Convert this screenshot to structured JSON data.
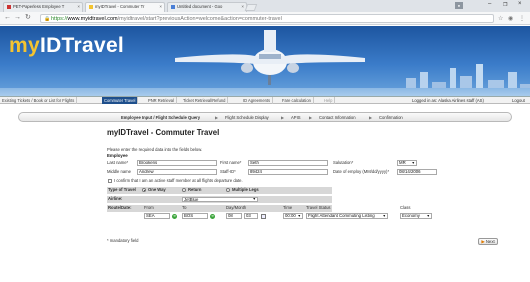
{
  "browser": {
    "tabs": [
      {
        "label": "PET-Paperless Employee T"
      },
      {
        "label": "myIDTravel - Commuter Tr"
      },
      {
        "label": "Untitled document - Goo"
      }
    ],
    "url_scheme": "https://",
    "url_host": "www.myidtravel.com",
    "url_path": "/myidtravel/start?previousAction=welcome&action=commuter-travel"
  },
  "banner": {
    "logo_my": "my",
    "logo_rest": "IDTravel"
  },
  "nav": {
    "items": [
      "Existing Tickets / Book or List for Flights",
      "Commuter Travel",
      "PNR Retrieval",
      "Ticket Retrieval/Refund",
      "ID Agreements",
      "Fare calculation",
      "Help"
    ],
    "logged_in": "Logged in as: Alaska Airlines staff (AS)",
    "logout": "Logout"
  },
  "steps": [
    "Employee Input / Flight Schedule Query",
    "Flight Schedule Display",
    "APIS",
    "Contact Information",
    "Confirmation"
  ],
  "form": {
    "title": "myIDTravel - Commuter Travel",
    "instructions": "Please enter the required data into the fields below.",
    "section_employee": "Employee",
    "last_name_label": "Last name*",
    "last_name": "Brookens",
    "first_name_label": "First name*",
    "first_name": "Seth",
    "salutation_label": "Salutation*",
    "salutation": "MR",
    "middle_name_label": "Middle name",
    "middle_name": "Andrew",
    "staff_id_label": "Staff-ID*",
    "staff_id": "89424",
    "doe_label": "Date of employ (MM/dd/yyyy)*",
    "doe": "08/14/2006",
    "confirm_text": "I confirm that I am an active staff member at all flights departure date.",
    "type_label": "Type of Travel",
    "type_options": [
      "One Way",
      "Return",
      "Multiple Legs"
    ],
    "airline_label": "Airline:",
    "airline": "JetBlue",
    "route_label": "Route/Date:",
    "from_label": "From",
    "to_label": "To",
    "daymonth_label": "Day/Month",
    "time_label": "Time",
    "status_label": "Travel Status",
    "class_label": "Class",
    "from": "SEA",
    "to": "BOS",
    "day": "08",
    "month": "03",
    "time": "00:00",
    "status": "Flight Attendant Commuting Listing",
    "class": "Economy",
    "mandatory_note": "* mandatory field",
    "next_label": "Next"
  }
}
